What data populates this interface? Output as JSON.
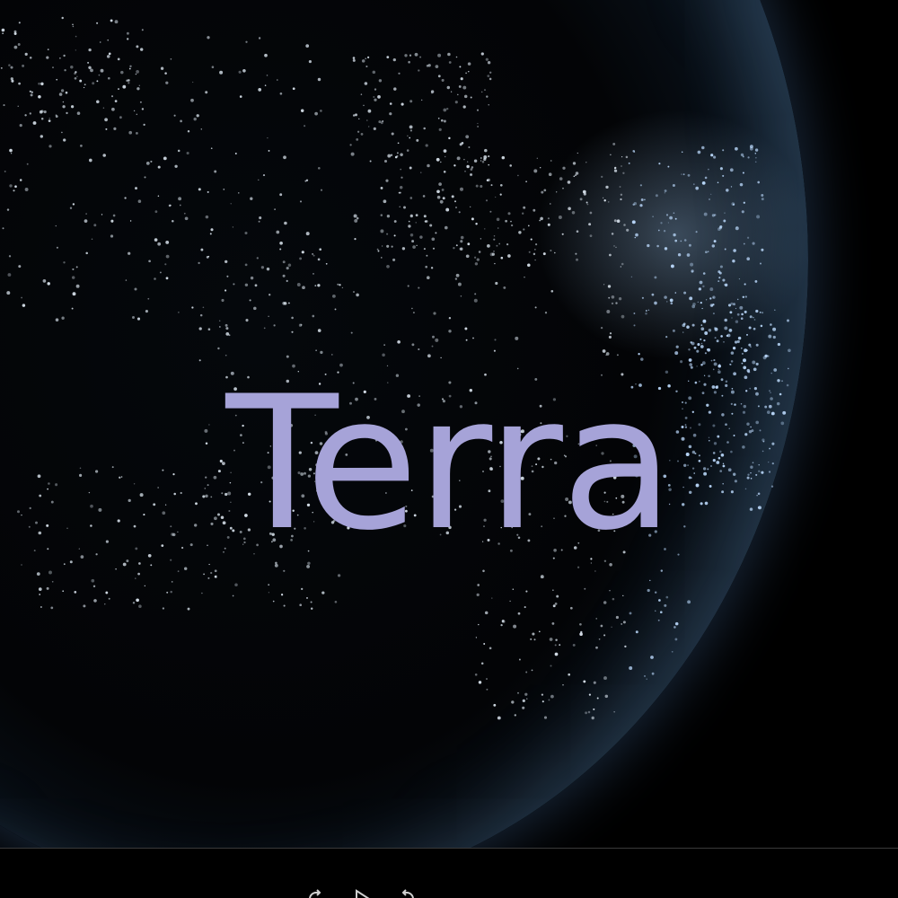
{
  "video": {
    "title_overlay": "Terra"
  },
  "controls": {
    "icons": [
      "rewind-icon",
      "play-icon",
      "forward-icon"
    ]
  },
  "colors": {
    "title": "#a6a3d8",
    "background": "#000000",
    "globe_glow": "#6fa8e0"
  }
}
